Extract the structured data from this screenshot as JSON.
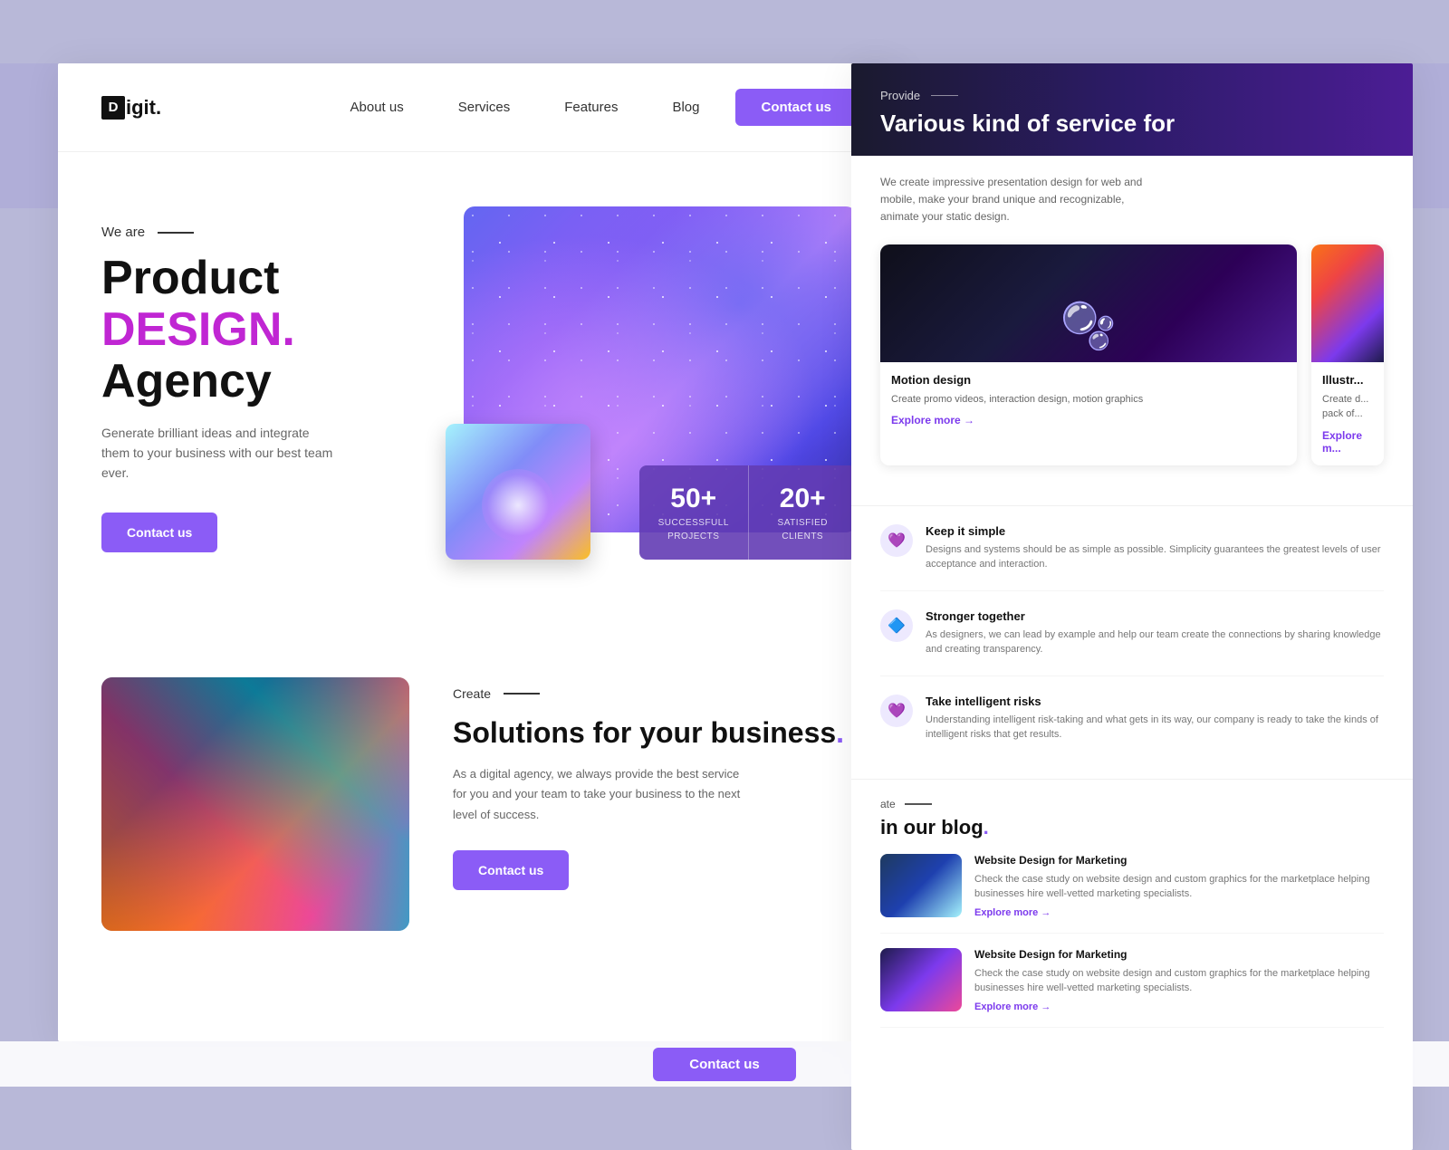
{
  "background": {
    "color": "#b0aed8"
  },
  "navbar": {
    "logo": "Digit.",
    "logo_letter": "D",
    "nav_links": [
      {
        "label": "About us",
        "id": "about"
      },
      {
        "label": "Services",
        "id": "services"
      },
      {
        "label": "Features",
        "id": "features"
      },
      {
        "label": "Blog",
        "id": "blog"
      }
    ],
    "contact_btn": "Contact us"
  },
  "hero": {
    "we_are": "We are",
    "title_line1": "Product",
    "title_line2": "DESIGN.",
    "title_line3": "Agency",
    "description": "Generate brilliant ideas and integrate them to your business with our best team ever.",
    "contact_btn": "Contact us",
    "stats": [
      {
        "number": "50+",
        "label1": "SUCCESSFULL",
        "label2": "PROJECTS"
      },
      {
        "number": "20+",
        "label1": "SATISFIED",
        "label2": "CLIENTS"
      }
    ]
  },
  "second_section": {
    "create_label": "Create",
    "title": "Solutions for your business.",
    "description": "As a digital agency, we always provide the best service for you and your team to take your business to the next level of success.",
    "contact_btn": "Contact us"
  },
  "right_panel": {
    "provide_label": "Provide",
    "title": "Various kind of service for",
    "description": "We create impressive presentation design for web and mobile, make your brand unique and recognizable, animate your static design.",
    "cards": [
      {
        "type": "dark",
        "title": "Motion design",
        "description": "Create promo videos, interaction design, motion graphics",
        "explore": "Explore more →"
      },
      {
        "type": "orange",
        "title": "Illustr...",
        "description": "Create d... pack of...",
        "explore": "Explore m..."
      }
    ],
    "values": [
      {
        "icon": "💜",
        "title": "Keep it simple",
        "description": "Designs and systems should be as simple as possible. Simplicity guarantees the greatest levels of user acceptance and interaction."
      },
      {
        "icon": "🔷",
        "title": "Stronger together",
        "description": "As designers, we can lead by example and help our team create the connections by sharing knowledge and creating transparency."
      },
      {
        "icon": "💜",
        "title": "Take intelligent risks",
        "description": "Understanding intelligent risk-taking and what gets in its way, our company is ready to take the kinds of intelligent risks that get results."
      }
    ],
    "blog": {
      "label": "ate",
      "title_prefix": "in our blog",
      "title_dot": ".",
      "items": [
        {
          "type": "blue",
          "title": "Website Design for Marketing",
          "description": "Check the case study on website design and custom graphics for the marketplace helping businesses hire well-vetted marketing specialists.",
          "explore": "Explore more →"
        },
        {
          "type": "purple",
          "title": "Website Design for Marketing",
          "description": "Check the case study on website design and custom graphics for the marketplace helping businesses hire well-vetted marketing specialists.",
          "explore": "Explore more →"
        }
      ]
    }
  },
  "bottom": {
    "contact_btn": "Contact us"
  }
}
